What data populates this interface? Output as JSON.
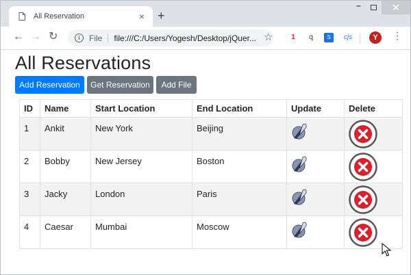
{
  "browser": {
    "tab_title": "All Reservation",
    "new_tab": "+",
    "tab_close": "×",
    "url_scheme": "File",
    "url": "file:///C:/Users/Yogesh/Desktop/jQuer...",
    "extensions": [
      "1",
      "ꝗ",
      "S",
      "cjs"
    ],
    "profile_initial": "Y",
    "window_controls": {
      "minimize": "–",
      "close": "✕"
    }
  },
  "page": {
    "title": "All Reservations",
    "buttons": {
      "add": "Add Reservation",
      "get": "Get Reservation",
      "file": "Add File"
    },
    "table": {
      "headers": [
        "ID",
        "Name",
        "Start Location",
        "End Location",
        "Update",
        "Delete"
      ],
      "rows": [
        {
          "id": "1",
          "name": "Ankit",
          "start": "New York",
          "end": "Beijing"
        },
        {
          "id": "2",
          "name": "Bobby",
          "start": "New Jersey",
          "end": "Boston"
        },
        {
          "id": "3",
          "name": "Jacky",
          "start": "London",
          "end": "Paris"
        },
        {
          "id": "4",
          "name": "Caesar",
          "start": "Mumbai",
          "end": "Moscow"
        }
      ]
    }
  },
  "icons": {
    "update": "feather-pen-icon",
    "delete": "delete-circle-icon"
  },
  "colors": {
    "primary": "#007bff",
    "secondary": "#6c757d",
    "delete_red": "#dc1e2d"
  }
}
